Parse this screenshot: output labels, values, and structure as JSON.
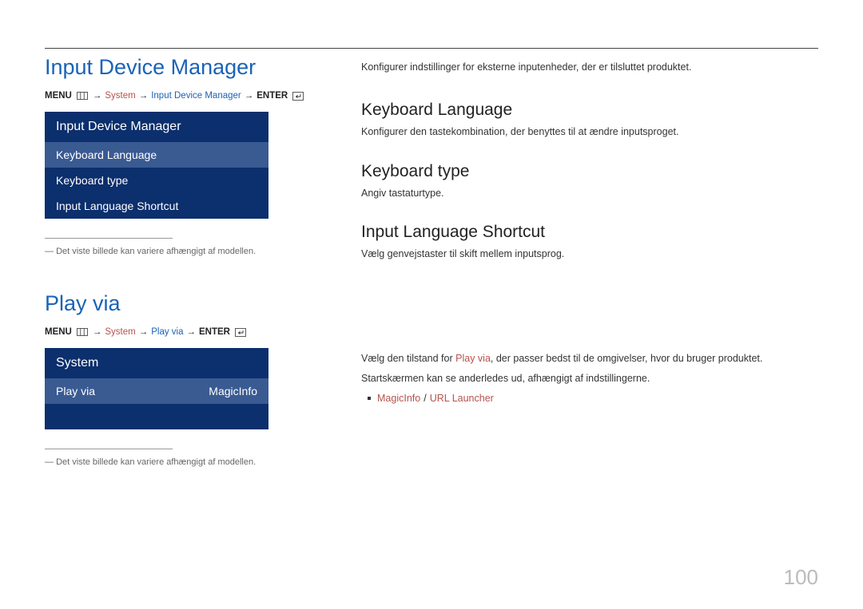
{
  "top": {
    "h1": "Input Device Manager",
    "breadcrumb": {
      "menu": "MENU",
      "arrow": "→",
      "system": "System",
      "idm": "Input Device Manager",
      "enter": "ENTER"
    },
    "menu": {
      "title": "Input Device Manager",
      "items": [
        "Keyboard Language",
        "Keyboard type",
        "Input Language Shortcut"
      ]
    },
    "note": "Det viste billede kan variere afhængigt af modellen."
  },
  "bottom": {
    "h1": "Play via",
    "menu": {
      "title": "System",
      "item_label": "Play via",
      "item_value": "MagicInfo"
    },
    "breadcrumb": {
      "playvia": "Play via"
    },
    "note": "Det viste billede kan variere afhængigt af modellen."
  },
  "right": {
    "intro": "Konfigurer indstillinger for eksterne inputenheder, der er tilsluttet produktet.",
    "kl_h": "Keyboard Language",
    "kl_p": "Konfigurer den tastekombination, der benyttes til at ændre inputsproget.",
    "kt_h": "Keyboard type",
    "kt_p": "Angiv tastaturtype.",
    "ils_h": "Input Language Shortcut",
    "ils_p": "Vælg genvejstaster til skift mellem inputsprog.",
    "pv_p1a": "Vælg den tilstand for ",
    "pv_p1b": "Play via",
    "pv_p1c": ", der passer bedst til de omgivelser, hvor du bruger produktet.",
    "pv_p2": "Startskærmen kan se anderledes ud, afhængigt af indstillingerne.",
    "pv_opt1": "MagicInfo",
    "pv_sep": " / ",
    "pv_opt2": "URL Launcher"
  },
  "page": "100"
}
